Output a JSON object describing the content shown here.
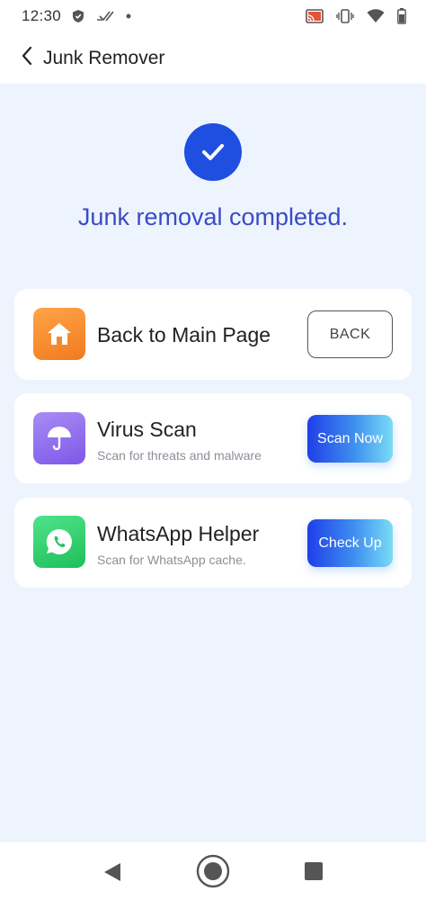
{
  "status_bar": {
    "time": "12:30",
    "icons": [
      "shield-icon",
      "signal-check-icon",
      "dot-icon",
      "cast-icon",
      "vibrate-icon",
      "wifi-icon",
      "battery-icon"
    ]
  },
  "app_bar": {
    "title": "Junk Remover",
    "back_icon": "chevron-left-icon"
  },
  "result": {
    "icon": "check-circle-icon",
    "message": "Junk removal completed.",
    "accent": "#1e4fe0",
    "message_color": "#3a4bc6"
  },
  "cards": [
    {
      "icon": "home-icon",
      "title": "Back to Main Page",
      "subtitle": "",
      "button": "BACK"
    },
    {
      "icon": "umbrella-icon",
      "title": "Virus Scan",
      "subtitle": "Scan for threats and malware",
      "button": "Scan Now"
    },
    {
      "icon": "whatsapp-icon",
      "title": "WhatsApp Helper",
      "subtitle": "Scan for WhatsApp cache.",
      "button": "Check Up"
    }
  ],
  "nav_bar": {
    "icons": [
      "nav-back-icon",
      "nav-home-icon",
      "nav-recents-icon"
    ]
  }
}
